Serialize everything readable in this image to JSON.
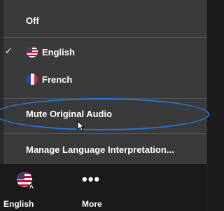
{
  "menu": {
    "items": [
      {
        "label": "Off"
      },
      {
        "label": "English",
        "checked": true,
        "icon": "us-flag-icon"
      },
      {
        "label": "French",
        "icon": "france-flag-icon"
      },
      {
        "label": "Mute Original Audio"
      },
      {
        "label": "Manage Language Interpretation..."
      }
    ],
    "check_mark": "✓"
  },
  "bottom_bar": {
    "language_label": "English",
    "language_icon": "us-flag-icon",
    "more_label": "More",
    "more_icon": "ellipsis-icon",
    "more_glyph": "•••"
  },
  "colors": {
    "menu_bg": "#3a3a3a",
    "bar_bg": "#1a1a1a",
    "highlight_ring": "#1e78e6",
    "text": "#ffffff"
  }
}
